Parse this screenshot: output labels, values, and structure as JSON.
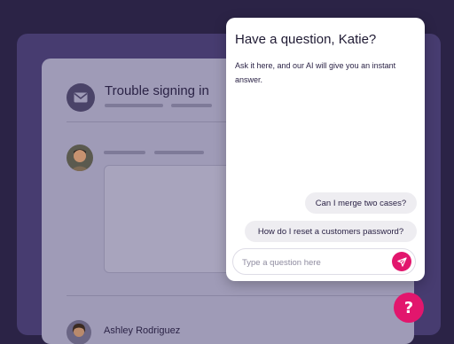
{
  "ticket": {
    "title": "Trouble signing in",
    "agent_name": "Ashley Rodriguez",
    "mail_icon": "mail-icon"
  },
  "chat": {
    "title": "Have a question, Katie?",
    "subtitle": "Ask it here, and our AI will give you an instant answer.",
    "suggestions": [
      "Can I merge two cases?",
      "How do I reset a customers password?"
    ],
    "input_placeholder": "Type a question here",
    "send_icon": "send-icon"
  },
  "help_button": {
    "label": "?"
  },
  "colors": {
    "background": "#2b2346",
    "accent": "#e2166d",
    "panel": "#ffffff"
  }
}
